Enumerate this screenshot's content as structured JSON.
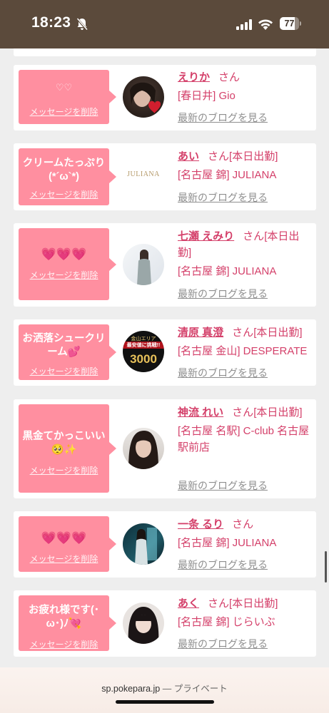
{
  "status_bar": {
    "time": "18:23",
    "battery": "77",
    "battery_level": 0.77,
    "icons": [
      "bell-slash-icon",
      "signal-icon",
      "wifi-icon",
      "battery-icon"
    ]
  },
  "delete_label": "メッセージを削除",
  "blog_label": "最新のブログを見る",
  "san_label": "さん",
  "accent_color": "#ff8fa0",
  "name_color": "#d4406a",
  "messages": [
    {
      "message": "♡♡",
      "name": "えりか",
      "status": "",
      "shop": "[春日井] Gio"
    },
    {
      "message": "クリームたっぷり(*´ω`*)",
      "name": "あい",
      "status": "[本日出勤]",
      "shop": "[名古屋 錦] JULIANA"
    },
    {
      "message": "💗💗💗",
      "name": "七瀬 えみり",
      "status": "[本日出勤]",
      "shop": "[名古屋 錦] JULIANA"
    },
    {
      "message": "お洒落シュークリーム💕",
      "name": "清原 真澄",
      "status": "[本日出勤]",
      "shop": "[名古屋 金山] DESPERATE"
    },
    {
      "message": "黒金てかっこいい🥺✨",
      "name": "神流 れい",
      "status": "[本日出勤]",
      "shop": "[名古屋 名駅] C-club 名古屋駅前店"
    },
    {
      "message": "💗💗💗",
      "name": "一条 るり",
      "status": "",
      "shop": "[名古屋 錦] JULIANA"
    },
    {
      "message": "お疲れ様です(･ω･)ﾉ💘",
      "name": "あく",
      "status": "[本日出勤]",
      "shop": "[名古屋 錦] じらいぶ"
    }
  ],
  "avatar_labels": {
    "juliana_logo": "JULIANA",
    "banner_top": "金山エリア",
    "banner_mid": "最安値に挑戦!!",
    "banner_price": "3000"
  },
  "bottom_bar": {
    "url": "sp.pokepara.jp",
    "separator": " — ",
    "mode": "プライベート"
  }
}
